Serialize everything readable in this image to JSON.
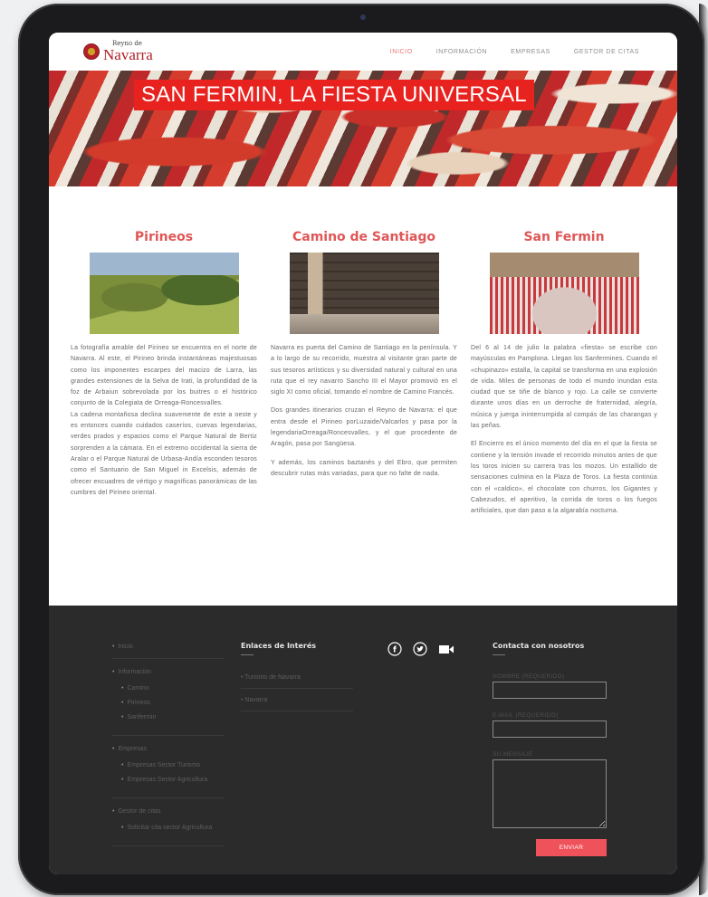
{
  "header": {
    "logo_small": "Reyno de",
    "logo_big": "Navarra",
    "nav": [
      "INICIO",
      "INFORMACIÓN",
      "EMPRESAS",
      "GESTOR DE CITAS"
    ]
  },
  "hero": {
    "title": "SAN FERMIN, LA FIESTA UNIVERSAL"
  },
  "columns": [
    {
      "title": "Pirineos",
      "paragraphs": [
        "La fotografía amable del Pirineo se encuentra en el norte de Navarra. Al este, el Pirineo brinda instantáneas majestuosas como los imponentes escarpes del macizo de Larra, las grandes extensiones de la Selva de Irati, la profundidad de la foz de Arbaiun sobrevolada por los buitres o el histórico conjunto de la Colegiata de Orreaga-Roncesvalles.",
        "La cadena montañosa declina suavemente de este a oeste y es entonces cuando cuidados caseríos, cuevas legendarias, verdes prados y espacios como el Parque Natural de Bertiz sorprenden a la cámara. En el extremo occidental la sierra de Aralar o el Parque Natural de Urbasa-Andía esconden tesoros como el Santuario de San Miguel in Excelsis, además de ofrecer encuadres de vértigo y magníficas panorámicas de las cumbres del Pirineo oriental."
      ]
    },
    {
      "title": "Camino de Santiago",
      "paragraphs": [
        "Navarra es puerta del Camino de Santiago en la península. Y a lo largo de su recorrido, muestra al visitante gran parte de sus tesoros artísticos y su diversidad natural y cultural en una ruta que el rey navarro Sancho III el Mayor promovió en el siglo XI como oficial, tomando el nombre de Camino Francés.",
        "Dos grandes itinerarios cruzan el Reyno de Navarra: el que entra desde el Pirineo porLuzaide/Valcarlos y pasa por la legendariaOrreaga/Roncesvalles, y el que procedente de Aragón, pasa por Sangüesa.",
        "Y además, los caminos baztanés y del Ebro, que permiten descubrir rutas más variadas, para que no falte de nada."
      ]
    },
    {
      "title": "San Fermin",
      "paragraphs": [
        "Del 6 al 14 de julio la palabra «fiesta» se escribe con mayúsculas en Pamplona. Llegan los Sanfermines. Cuando el «chupinazo» estalla, la capital se transforma en una explosión de vida. Miles de personas de todo el mundo inundan esta ciudad que se tiñe de blanco y rojo. La calle se convierte durante unos días en un derroche de fraternidad, alegría, música y juerga ininterrumpida al compás de las charangas y las peñas.",
        "El Encierro es el único momento del día en el que la fiesta se contiene y la tensión invade el recorrido minutos antes de que los toros inicien su carrera tras los mozos. Un estallido de sensaciones culmina en la Plaza de Toros. La fiesta continúa con el «caldico», el chocolate con churros, los Gigantes y Cabezudos, el aperitivo, la corrida de toros o los fuegos artificiales, que dan paso a la algarabía nocturna."
      ]
    }
  ],
  "footer": {
    "menu": {
      "inicio": "Inicio",
      "informacion": "Información",
      "informacion_sub": [
        "Camino",
        "Pirineos",
        "Sanfermin"
      ],
      "empresas": "Empresas",
      "empresas_sub": [
        "Empresas Sector Turismo",
        "Empresas Sector Agricultura"
      ],
      "gestor": "Gestor de citas",
      "gestor_sub": [
        "Solicitar cita sector Agricultura"
      ]
    },
    "links_title": "Enlaces de Interés",
    "links": [
      "Turismo de Navarra",
      "Navarra"
    ],
    "contact_title": "Contacta con nosotros",
    "contact": {
      "name_label": "NOMBRE (REQUERIDO)",
      "email_label": "E-MAIL (REQUERIDO)",
      "message_label": "SU MENSAJE",
      "send_label": "ENVIAR"
    },
    "social_icons": [
      "facebook-icon",
      "twitter-icon",
      "video-camera-icon"
    ]
  },
  "colors": {
    "accent": "#e8221f",
    "heading": "#e05556",
    "footer_bg": "#2b2b2c",
    "button": "#f0525b"
  }
}
